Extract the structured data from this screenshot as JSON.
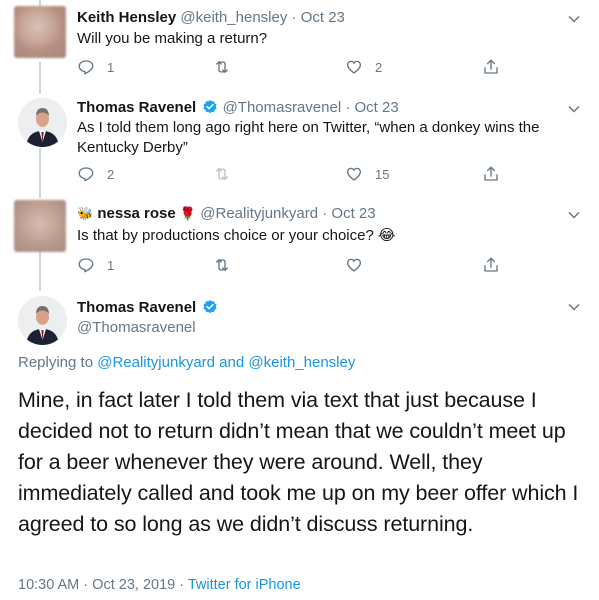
{
  "tweets": [
    {
      "name": "Keith Hensley",
      "handle": "@keith_hensley",
      "separator": "·",
      "date": "Oct 23",
      "text": "Will you be making a return?",
      "reply_count": "1",
      "retweet_count": "",
      "like_count": "2"
    },
    {
      "name": "Thomas Ravenel",
      "handle": "@Thomasravenel",
      "separator": "·",
      "date": "Oct 23",
      "text": "As I told them long ago right here on Twitter, “when a donkey wins the Kentucky Derby”",
      "reply_count": "2",
      "retweet_count": "",
      "like_count": "15"
    },
    {
      "name_prefix_emoji": "🐝",
      "name": "nessa rose",
      "name_suffix_emoji": "🌹",
      "handle": "@Realityjunkyard",
      "separator": "·",
      "date": "Oct 23",
      "text": "Is that by productions choice or your choice? 😂",
      "reply_count": "1",
      "retweet_count": "",
      "like_count": ""
    }
  ],
  "main_tweet": {
    "name": "Thomas Ravenel",
    "handle": "@Thomasravenel",
    "replying_prefix": "Replying to",
    "replying_user1": "@Realityjunkyard",
    "replying_and": "and",
    "replying_user2": "@keith_hensley",
    "text": "Mine, in fact later I told them via text that just because I decided not to return didn’t mean that we couldn’t meet up for a beer whenever they were around. Well, they immediately called and took me up on my beer offer which I agreed to so long as we didn’t discuss returning.",
    "time": "10:30 AM",
    "separator": "·",
    "date": "Oct 23, 2019",
    "source": "Twitter for iPhone"
  },
  "colors": {
    "accent": "#1b95e0",
    "muted": "#657786",
    "text": "#14171a",
    "verified": "#1da1f2",
    "thread_line": "#ccd6dd"
  },
  "icons": [
    "reply-icon",
    "retweet-icon",
    "like-icon",
    "share-icon",
    "chevron-down-icon",
    "verified-badge-icon"
  ]
}
